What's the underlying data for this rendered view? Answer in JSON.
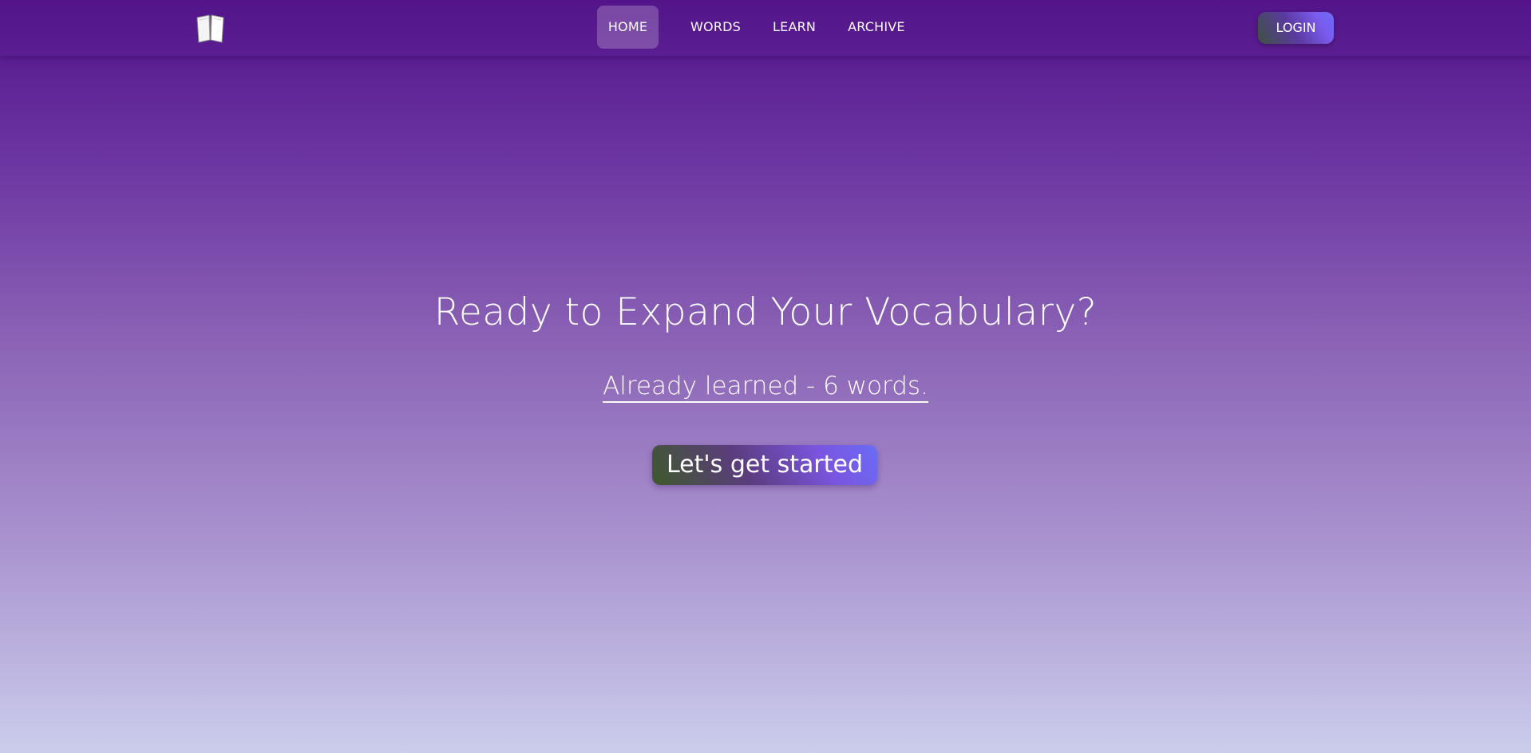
{
  "nav": {
    "logo_icon": "open-book-icon",
    "links": [
      {
        "label": "HOME",
        "active": true
      },
      {
        "label": "WORDS",
        "active": false
      },
      {
        "label": "LEARN",
        "active": false
      },
      {
        "label": "ARCHIVE",
        "active": false
      }
    ],
    "login_label": "LOGIN"
  },
  "hero": {
    "title": "Ready to Expand Your Vocabulary?",
    "learned_text": "Already learned - 6 words.",
    "cta_label": "Let's get started"
  },
  "colors": {
    "nav_bg": "#53148a",
    "background_top": "#52128a",
    "background_bottom": "#cbcdec",
    "button_accent": "#7a5cf0"
  }
}
